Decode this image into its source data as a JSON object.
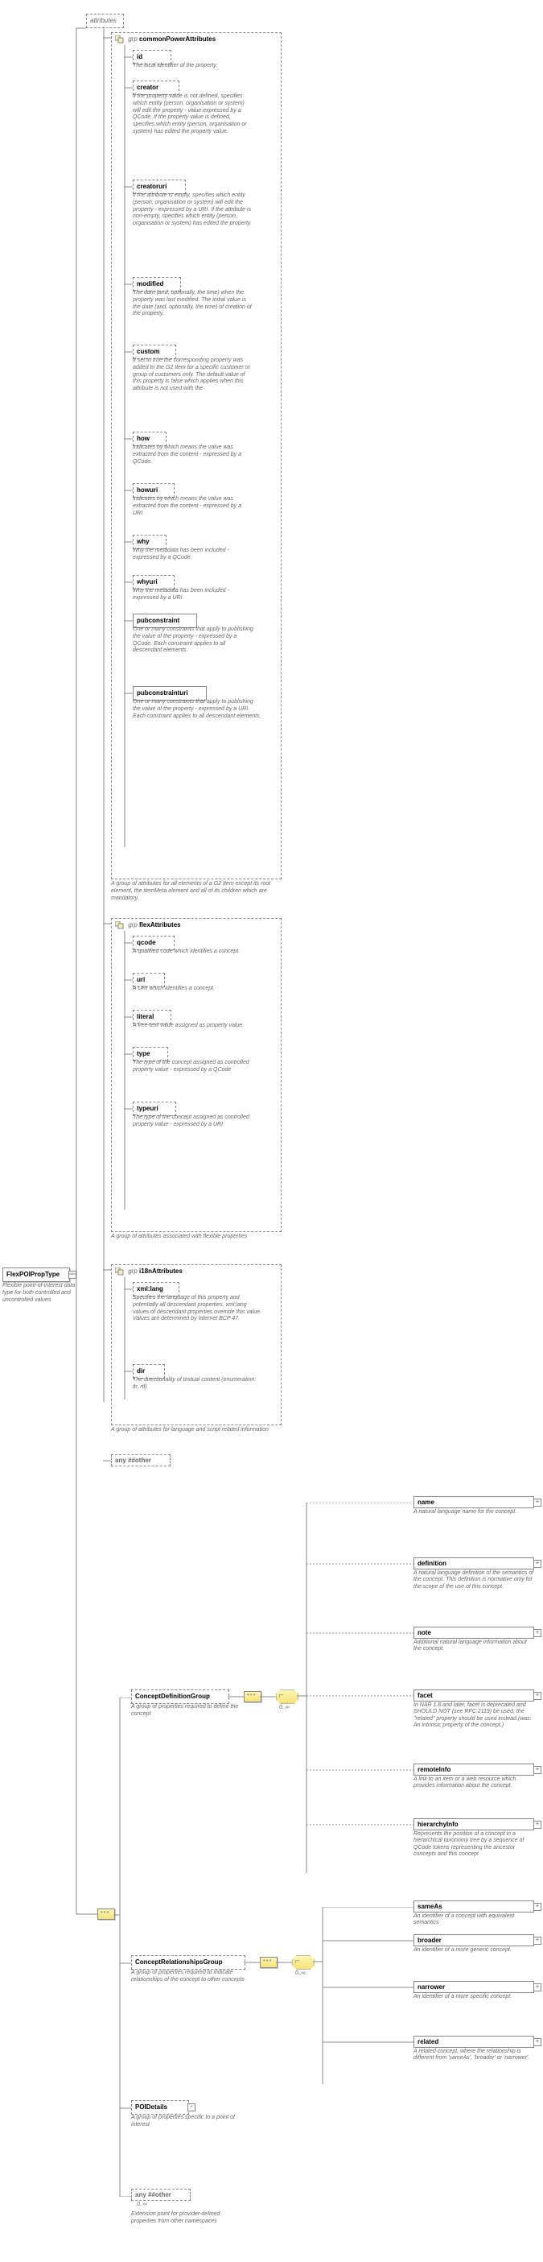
{
  "root": {
    "name": "FlexPOIPropType",
    "desc": "Flexible point-of-interest data type for both controlled and uncontrolled values"
  },
  "attributes_label": "attributes",
  "grp_common": {
    "label": "grp",
    "name": "commonPowerAttributes",
    "items": [
      {
        "name": "id",
        "desc": "The local identifier of the property."
      },
      {
        "name": "creator",
        "desc": "If the property value is not defined, specifies which entity (person, organisation or system) will edit the property - value expressed by a QCode. If the property value is defined, specifies which entity (person, organisation or system) has edited the property value."
      },
      {
        "name": "creatoruri",
        "desc": "If the attribute is empty, specifies which entity (person, organisation or system) will edit the property - expressed by a URI. If the attribute is non-empty, specifies which entity (person, organisation or system) has edited the property."
      },
      {
        "name": "modified",
        "desc": "The date (and, optionally, the time) when the property was last modified. The initial value is the date (and, optionally, the time) of creation of the property."
      },
      {
        "name": "custom",
        "desc": "If set to true the corresponding property was added to the G2 Item for a specific customer or group of customers only. The default value of this property is false which applies when this attribute is not used with the"
      },
      {
        "name": "how",
        "desc": "Indicates by which means the value was extracted from the content - expressed by a QCode."
      },
      {
        "name": "howuri",
        "desc": "Indicates by which means the value was extracted from the content - expressed by a URI."
      },
      {
        "name": "why",
        "desc": "Why the metadata has been included - expressed by a QCode."
      },
      {
        "name": "whyuri",
        "desc": "Why the metadata has been included - expressed by a URI."
      },
      {
        "name": "pubconstraint",
        "desc": "One or many constraints that apply to publishing the value of the property - expressed by a QCode. Each constraint applies to all descendant elements."
      },
      {
        "name": "pubconstrainturi",
        "desc": "One or many constraints that apply to publishing the value of the property - expressed by a URI. Each constraint applies to all descendant elements."
      }
    ],
    "foot": "A group of attributes for all elements of a G2 Item except its root element, the itemMeta element and all of its children which are mandatory."
  },
  "grp_flex": {
    "label": "grp",
    "name": "flexAttributes",
    "items": [
      {
        "name": "qcode",
        "desc": "A qualified code which identifies a concept."
      },
      {
        "name": "uri",
        "desc": "A URI which identifies a concept."
      },
      {
        "name": "literal",
        "desc": "A free-text value assigned as property value."
      },
      {
        "name": "type",
        "desc": "The type of the concept assigned as controlled property value - expressed by a QCode"
      },
      {
        "name": "typeuri",
        "desc": "The type of the concept assigned as controlled property value - expressed by a URI"
      }
    ],
    "foot": "A group of attributes associated with flexible properties"
  },
  "grp_i18n": {
    "label": "grp",
    "name": "i18nAttributes",
    "items": [
      {
        "name": "xml:lang",
        "desc": "Specifies the language of this property and potentially all descendant properties. xml:lang values of descendant properties override this value. Values are determined by Internet BCP 47."
      },
      {
        "name": "dir",
        "desc": "The directionality of textual content (enumeration: ltr, rtl)"
      }
    ],
    "foot": "A group of attributes for language and script related information"
  },
  "any_attr": "any ##other",
  "conceptDef": {
    "name": "ConceptDefinitionGroup",
    "desc": "A group of properties required to define the concept",
    "mult": "0..∞",
    "children": [
      {
        "name": "name",
        "desc": "A natural language name for the concept."
      },
      {
        "name": "definition",
        "desc": "A natural language definition of the semantics of the concept. This definition is normative only for the scope of the use of this concept."
      },
      {
        "name": "note",
        "desc": "Additional natural language information about the concept."
      },
      {
        "name": "facet",
        "desc": "In NAR 1.8 and later, facet is deprecated and SHOULD NOT (see RFC 2119) be used, the \"related\" property should be used instead.(was: An intrinsic property of the concept.)"
      },
      {
        "name": "remoteInfo",
        "desc": "A link to an item or a web resource which provides information about the concept."
      },
      {
        "name": "hierarchyInfo",
        "desc": "Represents the position of a concept in a hierarchical taxonomy tree by a sequence of QCode tokens representing the ancestor concepts and this concept"
      }
    ]
  },
  "conceptRel": {
    "name": "ConceptRelationshipsGroup",
    "desc": "A group of properties required to indicate relationships of the concept to other concepts",
    "mult": "0..∞",
    "children": [
      {
        "name": "sameAs",
        "desc": "An identifier of a concept with equivalent semantics"
      },
      {
        "name": "broader",
        "desc": "An identifier of a more generic concept."
      },
      {
        "name": "narrower",
        "desc": "An identifier of a more specific concept."
      },
      {
        "name": "related",
        "desc": "A related concept, where the relationship is different from 'sameAs', 'broader' or 'narrower'."
      }
    ]
  },
  "poiDetails": {
    "name": "POIDetails",
    "desc": "A group of properties specific to a point of interest"
  },
  "anyOther": {
    "name": "any ##other",
    "mult": "0..∞",
    "desc": "Extension point for provider-defined properties from other namespaces"
  }
}
